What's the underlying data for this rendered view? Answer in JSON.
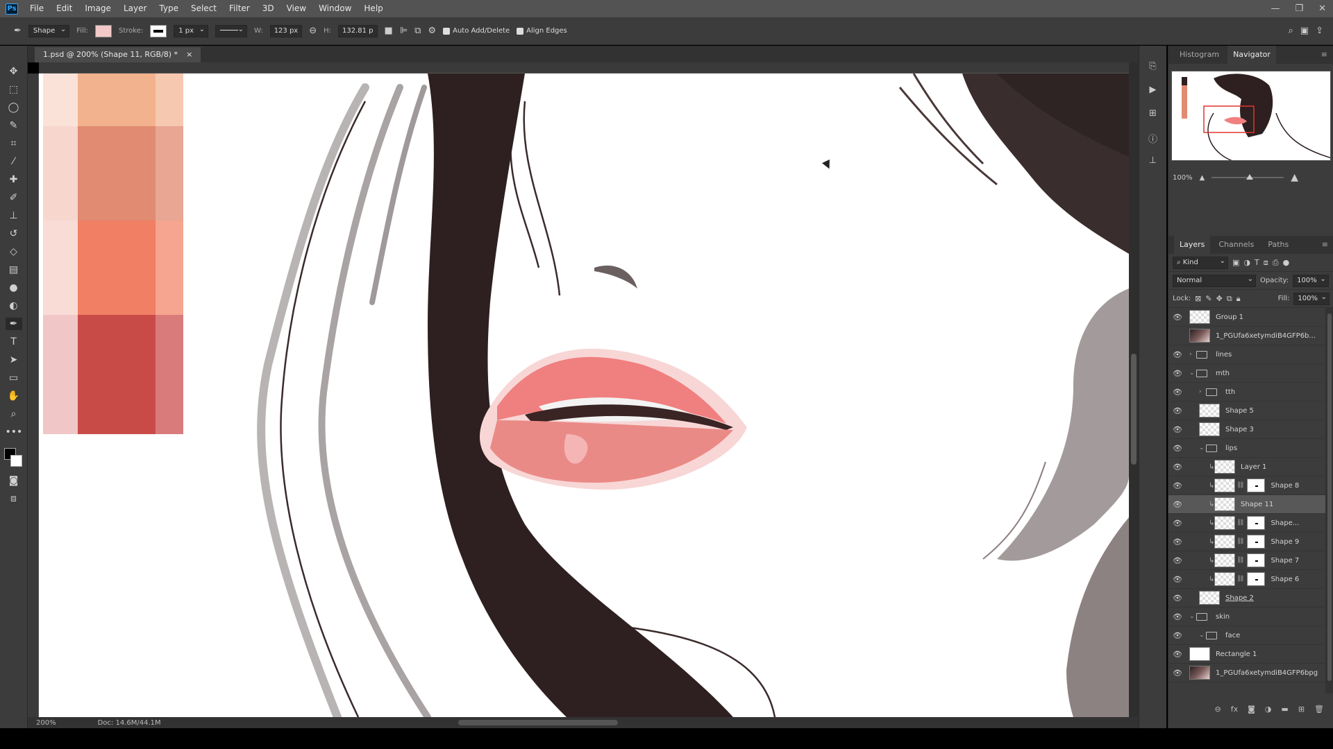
{
  "app": {
    "logo": "Ps"
  },
  "menu": [
    "File",
    "Edit",
    "Image",
    "Layer",
    "Type",
    "Select",
    "Filter",
    "3D",
    "View",
    "Window",
    "Help"
  ],
  "window_controls": [
    "—",
    "❐",
    "✕"
  ],
  "options": {
    "tool_mode": "Shape",
    "fill_label": "Fill:",
    "fill_color": "#f2c9c8",
    "stroke_label": "Stroke:",
    "stroke_width": "1 px",
    "w_label": "W:",
    "w_value": "123 px",
    "h_label": "H:",
    "h_value": "132.81 p",
    "auto_add_delete": "Auto Add/Delete",
    "align_edges": "Align Edges"
  },
  "document": {
    "tab_title": "1.psd @ 200% (Shape 11, RGB/8) *",
    "close": "×",
    "zoom": "200%",
    "doc_size": "Doc: 14.6M/44.1M"
  },
  "palette_swatches": {
    "left_column": [
      "#fbe2d8",
      "#f7d6ce",
      "#f9dcd5",
      "#f0c6c6"
    ],
    "main_column": [
      "#f2b28d",
      "#e08b72",
      "#f07f64",
      "#c94b48"
    ],
    "right_column": [
      "#f7c8b0",
      "#e8a693",
      "#f5a590",
      "#da7b7b"
    ]
  },
  "navigator": {
    "tabs": [
      "Histogram",
      "Navigator"
    ],
    "active_tab": "Navigator",
    "zoom": "100%"
  },
  "layers": {
    "tabs": [
      "Layers",
      "Channels",
      "Paths"
    ],
    "active_tab": "Layers",
    "filter_kind": "Kind",
    "blend_mode": "Normal",
    "opacity_label": "Opacity:",
    "opacity": "100%",
    "lock_label": "Lock:",
    "fill_label": "Fill:",
    "fill": "100%",
    "items": [
      {
        "name": "Group 1",
        "thumb": "checker",
        "visible": true,
        "indent": 0
      },
      {
        "name": "1_PGUfa6xetymdiB4GFP6b...",
        "thumb": "photo",
        "visible": false,
        "indent": 0
      },
      {
        "name": "lines",
        "thumb": "folder",
        "visible": true,
        "indent": 0,
        "caret": "›"
      },
      {
        "name": "mth",
        "thumb": "folder",
        "visible": true,
        "indent": 0,
        "caret": "⌄"
      },
      {
        "name": "tth",
        "thumb": "folder",
        "visible": true,
        "indent": 1,
        "caret": "›"
      },
      {
        "name": "Shape 5",
        "thumb": "checker",
        "visible": true,
        "indent": 1
      },
      {
        "name": "Shape 3",
        "thumb": "checker",
        "visible": true,
        "indent": 1
      },
      {
        "name": "lips",
        "thumb": "folder",
        "visible": true,
        "indent": 1,
        "caret": "⌄"
      },
      {
        "name": "Layer 1",
        "thumb": "checker",
        "visible": true,
        "indent": 2,
        "clip": true
      },
      {
        "name": "Shape 8",
        "thumb": "checker",
        "visible": true,
        "indent": 2,
        "clip": true,
        "mask": true
      },
      {
        "name": "Shape 11",
        "thumb": "checker",
        "visible": true,
        "indent": 2,
        "clip": true,
        "selected": true
      },
      {
        "name": "Shape...",
        "thumb": "checker",
        "visible": true,
        "indent": 2,
        "clip": true,
        "mask": true
      },
      {
        "name": "Shape 9",
        "thumb": "checker",
        "visible": true,
        "indent": 2,
        "clip": true,
        "mask": true
      },
      {
        "name": "Shape 7",
        "thumb": "checker",
        "visible": true,
        "indent": 2,
        "clip": true,
        "mask": true
      },
      {
        "name": "Shape 6",
        "thumb": "checker",
        "visible": true,
        "indent": 2,
        "clip": true,
        "mask": true
      },
      {
        "name": "Shape 2",
        "thumb": "checker",
        "visible": true,
        "indent": 1,
        "underline": true
      },
      {
        "name": "skin",
        "thumb": "folder",
        "visible": true,
        "indent": 0,
        "caret": "⌄"
      },
      {
        "name": "face",
        "thumb": "folder",
        "visible": true,
        "indent": 1,
        "caret": "⌄"
      },
      {
        "name": "Rectangle 1",
        "thumb": "white",
        "visible": true,
        "indent": 0
      },
      {
        "name": "1_PGUfa6xetymdiB4GFP6bpg",
        "thumb": "photo",
        "visible": true,
        "indent": 0
      }
    ]
  }
}
